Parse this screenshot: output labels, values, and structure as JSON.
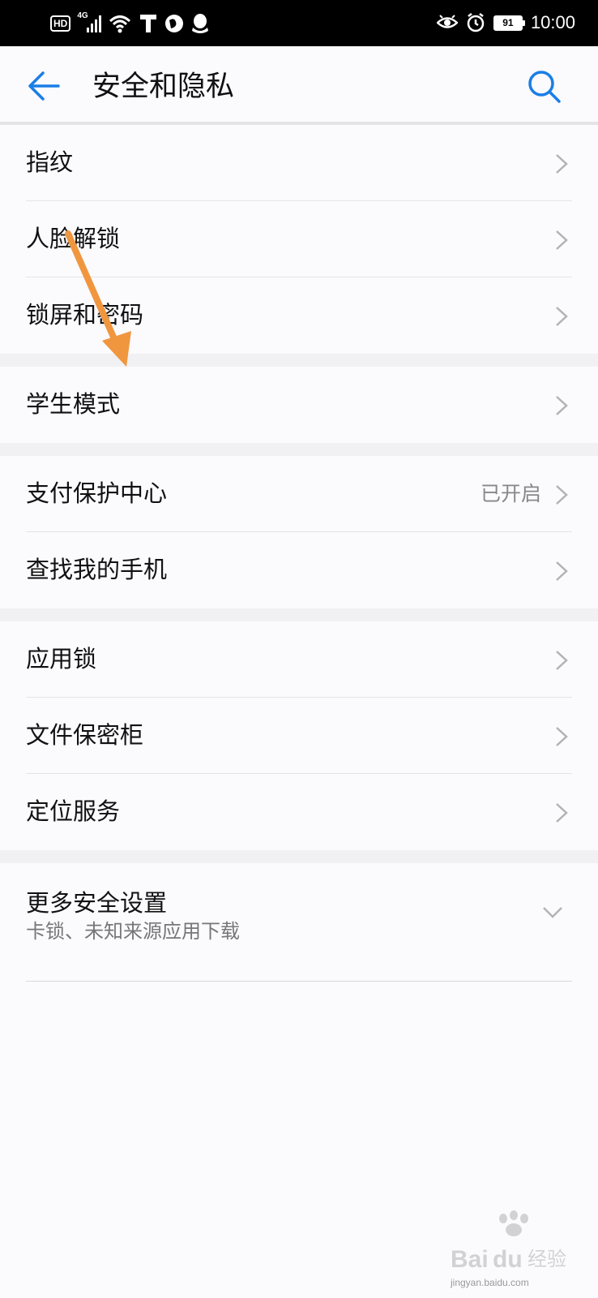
{
  "status_bar": {
    "network": "4G",
    "hd": "HD",
    "battery": "91",
    "time": "10:00"
  },
  "header": {
    "title": "安全和隐私"
  },
  "sections": [
    {
      "items": [
        {
          "label": "指纹"
        },
        {
          "label": "人脸解锁"
        },
        {
          "label": "锁屏和密码"
        }
      ]
    },
    {
      "items": [
        {
          "label": "学生模式"
        }
      ]
    },
    {
      "items": [
        {
          "label": "支付保护中心",
          "value": "已开启"
        },
        {
          "label": "查找我的手机"
        }
      ]
    },
    {
      "items": [
        {
          "label": "应用锁"
        },
        {
          "label": "文件保密柜"
        },
        {
          "label": "定位服务"
        }
      ]
    },
    {
      "items": [
        {
          "label": "更多安全设置",
          "sublabel": "卡锁、未知来源应用下载"
        }
      ]
    }
  ],
  "colors": {
    "accent": "#1a7ee6",
    "annotation_arrow": "#f0963f"
  },
  "watermark": {
    "logo": "Baidu经验",
    "url": "jingyan.baidu.com"
  }
}
